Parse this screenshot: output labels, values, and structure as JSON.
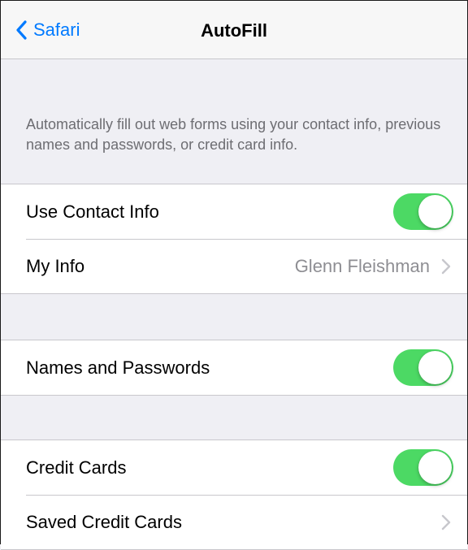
{
  "nav": {
    "back_label": "Safari",
    "title": "AutoFill"
  },
  "description": "Automatically fill out web forms using your contact info, previous names and passwords, or credit card info.",
  "groups": [
    {
      "cells": [
        {
          "label": "Use Contact Info",
          "type": "toggle",
          "on": true
        },
        {
          "label": "My Info",
          "type": "disclosure",
          "value": "Glenn Fleishman"
        }
      ]
    },
    {
      "cells": [
        {
          "label": "Names and Passwords",
          "type": "toggle",
          "on": true
        }
      ]
    },
    {
      "cells": [
        {
          "label": "Credit Cards",
          "type": "toggle",
          "on": true
        },
        {
          "label": "Saved Credit Cards",
          "type": "disclosure",
          "value": ""
        }
      ]
    }
  ],
  "colors": {
    "accent": "#007aff",
    "switch_on": "#4cd964",
    "background": "#efeff4"
  }
}
